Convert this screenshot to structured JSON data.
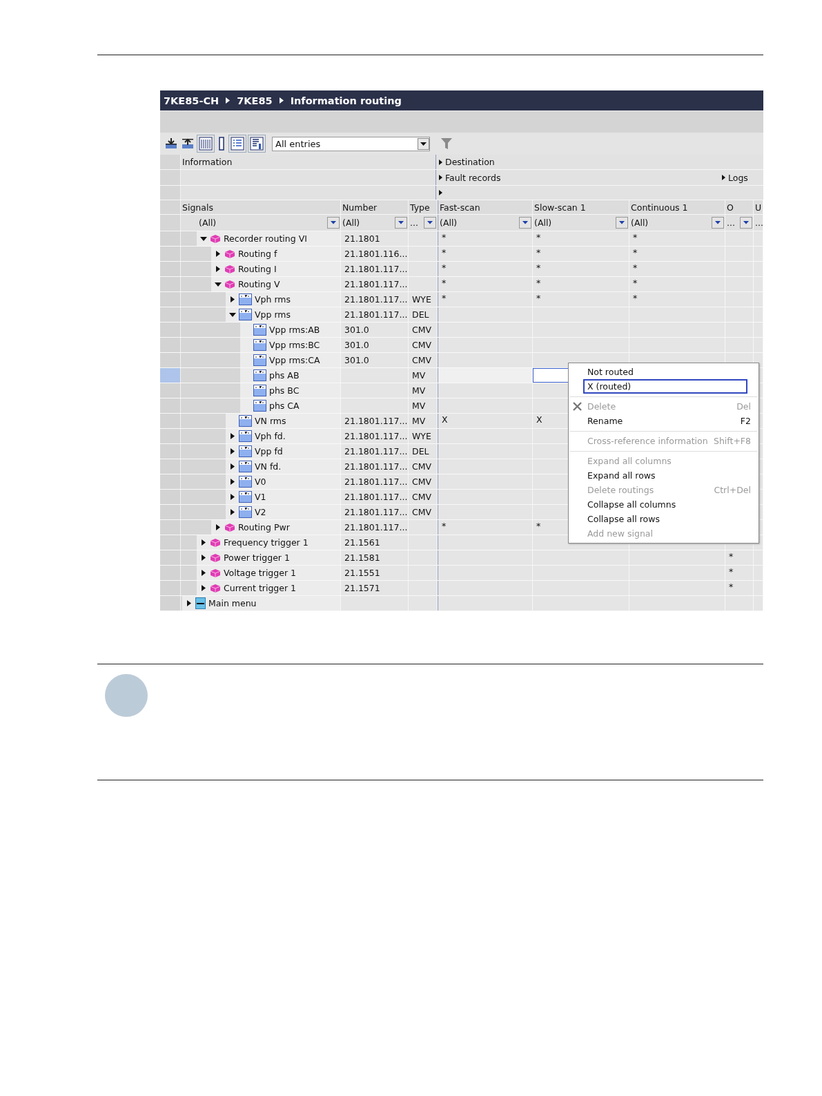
{
  "breadcrumb": [
    "7KE85-CH",
    "7KE85",
    "Information routing"
  ],
  "toolbar": {
    "filter": {
      "value": "All entries"
    }
  },
  "header_groups": {
    "information": "Information",
    "destination": "Destination",
    "fault_records": "Fault records",
    "logs": "Logs"
  },
  "columns": [
    {
      "label": "Signals",
      "filter": "(All)"
    },
    {
      "label": "Number",
      "filter": "(All)"
    },
    {
      "label": "Type",
      "filter": "..."
    },
    {
      "label": "Fast-scan",
      "filter": "(All)"
    },
    {
      "label": "Slow-scan 1",
      "filter": "(All)"
    },
    {
      "label": "Continuous 1",
      "filter": "(All)"
    },
    {
      "label": "O",
      "filter": "..."
    },
    {
      "label": "U",
      "filter": "..."
    }
  ],
  "rows": [
    {
      "children": [
        {
          "label": "Recorder routing VI",
          "number": "21.1801",
          "kind": "group",
          "expanded": true,
          "selected": false,
          "cells": {
            "fast_scan": "*",
            "slow_scan": "*",
            "continuous": "*"
          },
          "children": [
            {
              "label": "Routing f",
              "number": "21.1801.116...",
              "kind": "group",
              "expanded": false,
              "selected": false,
              "cells": {
                "fast_scan": "*",
                "slow_scan": "*",
                "continuous": "*"
              }
            },
            {
              "label": "Routing I",
              "number": "21.1801.117...",
              "kind": "group",
              "expanded": false,
              "selected": false,
              "cells": {
                "fast_scan": "*",
                "slow_scan": "*",
                "continuous": "*"
              }
            },
            {
              "label": "Routing V",
              "number": "21.1801.117...",
              "kind": "group",
              "expanded": true,
              "selected": false,
              "cells": {
                "fast_scan": "*",
                "slow_scan": "*",
                "continuous": "*"
              },
              "children": [
                {
                  "label": "Vph rms",
                  "number": "21.1801.117...",
                  "type": "WYE",
                  "kind": "signal",
                  "expanded": false,
                  "selected": false,
                  "cells": {
                    "fast_scan": "*",
                    "slow_scan": "*",
                    "continuous": "*"
                  }
                },
                {
                  "label": "Vpp rms",
                  "number": "21.1801.117...",
                  "type": "DEL",
                  "kind": "signal",
                  "expanded": true,
                  "selected": false,
                  "children": [
                    {
                      "label": "Vpp rms:AB",
                      "number": "301.0",
                      "type": "CMV",
                      "kind": "signal",
                      "selected": false
                    },
                    {
                      "label": "Vpp rms:BC",
                      "number": "301.0",
                      "type": "CMV",
                      "kind": "signal",
                      "selected": false
                    },
                    {
                      "label": "Vpp rms:CA",
                      "number": "301.0",
                      "type": "CMV",
                      "kind": "signal",
                      "selected": false
                    },
                    {
                      "label": "phs AB",
                      "type": "MV",
                      "kind": "signal",
                      "selected": true
                    },
                    {
                      "label": "phs BC",
                      "type": "MV",
                      "kind": "signal",
                      "selected": false
                    },
                    {
                      "label": "phs CA",
                      "type": "MV",
                      "kind": "signal",
                      "selected": false
                    }
                  ]
                },
                {
                  "label": "VN rms",
                  "number": "21.1801.117...",
                  "type": "MV",
                  "kind": "signal",
                  "selected": false,
                  "cells": {
                    "fast_scan": "X",
                    "slow_scan": "X"
                  }
                },
                {
                  "label": "Vph fd.",
                  "number": "21.1801.117...",
                  "type": "WYE",
                  "kind": "signal",
                  "expanded": false,
                  "selected": false
                },
                {
                  "label": "Vpp fd",
                  "number": "21.1801.117...",
                  "type": "DEL",
                  "kind": "signal",
                  "expanded": false,
                  "selected": false
                },
                {
                  "label": "VN fd.",
                  "number": "21.1801.117...",
                  "type": "CMV",
                  "kind": "signal",
                  "expanded": false,
                  "selected": false
                },
                {
                  "label": "V0",
                  "number": "21.1801.117...",
                  "type": "CMV",
                  "kind": "signal",
                  "expanded": false,
                  "selected": false
                },
                {
                  "label": "V1",
                  "number": "21.1801.117...",
                  "type": "CMV",
                  "kind": "signal",
                  "expanded": false,
                  "selected": false
                },
                {
                  "label": "V2",
                  "number": "21.1801.117...",
                  "type": "CMV",
                  "kind": "signal",
                  "expanded": false,
                  "selected": false
                }
              ]
            },
            {
              "label": "Routing Pwr",
              "number": "21.1801.117...",
              "kind": "group",
              "expanded": false,
              "selected": false,
              "cells": {
                "fast_scan": "*",
                "slow_scan": "*"
              }
            }
          ]
        },
        {
          "label": "Frequency trigger 1",
          "number": "21.1561",
          "kind": "group",
          "expanded": false,
          "selected": false
        },
        {
          "label": "Power trigger 1",
          "number": "21.1581",
          "kind": "group",
          "expanded": false,
          "selected": false,
          "cells": {
            "o": "*"
          }
        },
        {
          "label": "Voltage trigger 1",
          "number": "21.1551",
          "kind": "group",
          "expanded": false,
          "selected": false,
          "cells": {
            "o": "*"
          }
        },
        {
          "label": "Current trigger 1",
          "number": "21.1571",
          "kind": "group",
          "expanded": false,
          "selected": false,
          "cells": {
            "o": "*"
          }
        }
      ]
    },
    {
      "label": "Main menu",
      "kind": "menu",
      "expanded": false,
      "selected": false
    }
  ],
  "context_menu": {
    "groups": [
      [
        {
          "label": "Not routed",
          "kind": "plain",
          "disabled": false,
          "selected": false
        },
        {
          "label": "X (routed)",
          "kind": "plain",
          "disabled": false,
          "selected": true
        }
      ],
      [
        {
          "label": "Delete",
          "shortcut": "Del",
          "kind": "delete",
          "disabled": true,
          "selected": false
        },
        {
          "label": "Rename",
          "shortcut": "F2",
          "kind": "plain",
          "disabled": false,
          "selected": false
        }
      ],
      [
        {
          "label": "Cross-reference information",
          "shortcut": "Shift+F8",
          "kind": "plain",
          "disabled": true,
          "selected": false
        }
      ],
      [
        {
          "label": "Expand all columns",
          "kind": "plain",
          "disabled": true,
          "selected": false
        },
        {
          "label": "Expand all rows",
          "kind": "plain",
          "disabled": false,
          "selected": false
        },
        {
          "label": "Delete routings",
          "shortcut": "Ctrl+Del",
          "kind": "plain",
          "disabled": true,
          "selected": false
        },
        {
          "label": "Collapse all columns",
          "kind": "plain",
          "disabled": false,
          "selected": false
        },
        {
          "label": "Collapse all rows",
          "kind": "plain",
          "disabled": false,
          "selected": false
        },
        {
          "label": "Add new signal",
          "kind": "plain",
          "disabled": true,
          "selected": false
        }
      ]
    ]
  }
}
